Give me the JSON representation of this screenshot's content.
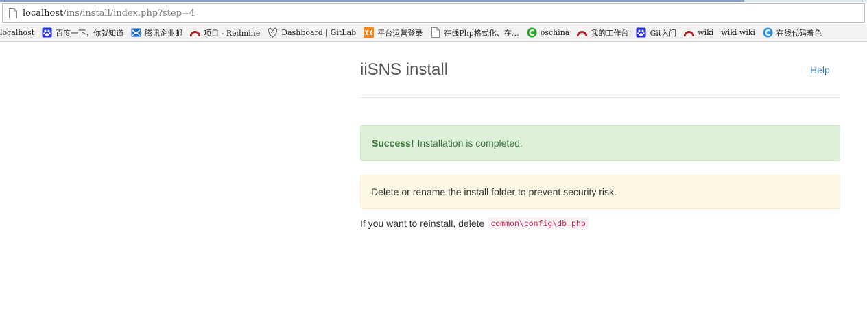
{
  "browser": {
    "url_host": "localhost",
    "url_path": "/ins/install/index.php?step=4",
    "bookmarks": [
      {
        "label": "localhost",
        "icon": "none"
      },
      {
        "label": "百度一下，你就知道",
        "icon": "baidu-paw-icon"
      },
      {
        "label": "腾讯企业邮",
        "icon": "tencent-mail-icon"
      },
      {
        "label": "项目 - Redmine",
        "icon": "redmine-icon"
      },
      {
        "label": "Dashboard | GitLab",
        "icon": "gitlab-fox-icon"
      },
      {
        "label": "平台运营登录",
        "icon": "platform-icon"
      },
      {
        "label": "在线Php格式化、在…",
        "icon": "page-icon"
      },
      {
        "label": "oschina",
        "icon": "oschina-icon"
      },
      {
        "label": "我的工作台",
        "icon": "redmine-icon"
      },
      {
        "label": "Git入门",
        "icon": "baidu-paw-icon"
      },
      {
        "label": "wiki",
        "icon": "redmine-icon"
      },
      {
        "label": "wiki wiki",
        "icon": "none"
      },
      {
        "label": "在线代码着色",
        "icon": "c-icon"
      }
    ]
  },
  "header": {
    "title": "iiSNS install",
    "help_label": "Help"
  },
  "alerts": {
    "success_strong": "Success!",
    "success_text": "Installation is completed.",
    "warning_text": "Delete or rename the install folder to prevent security risk."
  },
  "reinstall": {
    "text": "If you want to reinstall, delete",
    "code": "common\\config\\db.php"
  },
  "colors": {
    "link": "#337ab7",
    "success_bg": "#dff0d8",
    "success_text": "#3c763d",
    "warning_bg": "#fcf8e3",
    "code_text": "#c7254e"
  }
}
